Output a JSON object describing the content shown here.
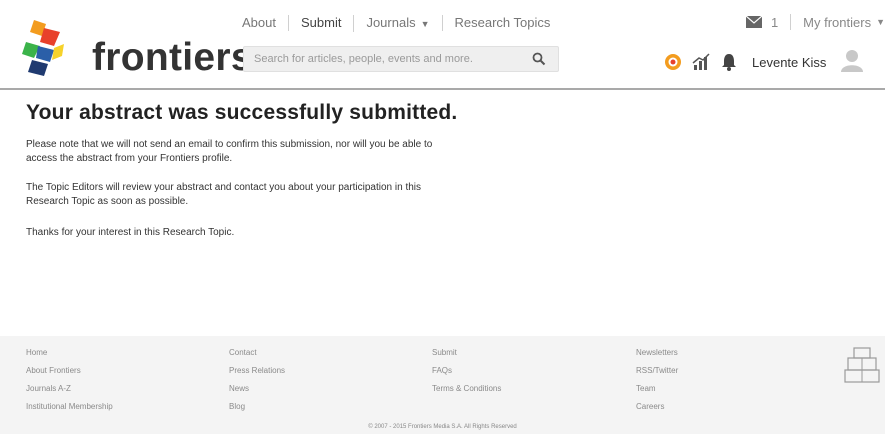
{
  "header": {
    "logo_text": "frontiers",
    "nav": [
      {
        "label": "About"
      },
      {
        "label": "Submit"
      },
      {
        "label": "Journals"
      },
      {
        "label": "Research Topics"
      }
    ],
    "search_placeholder": "Search for articles, people, events and more.",
    "mail_count": "1",
    "my_frontiers_label": "My frontiers",
    "user_name": "Levente Kiss"
  },
  "main": {
    "title": "Your abstract was successfully submitted.",
    "paragraph_1": "Please note that we will not send an email to confirm this submission, nor will you be able to access the abstract from your Frontiers profile.",
    "paragraph_2": "The Topic Editors will review your abstract and contact you about your participation in this Research Topic as soon as possible.",
    "paragraph_3": "Thanks for your interest in this Research Topic."
  },
  "footer": {
    "columns": [
      [
        "Home",
        "About Frontiers",
        "Journals A-Z",
        "Institutional Membership"
      ],
      [
        "Contact",
        "Press Relations",
        "News",
        "Blog"
      ],
      [
        "Submit",
        "FAQs",
        "Terms & Conditions"
      ],
      [
        "Newsletters",
        "RSS/Twitter",
        "Team",
        "Careers"
      ]
    ],
    "copyright": "© 2007 - 2015 Frontiers Media S.A. All Rights Reserved"
  },
  "colors": {
    "logo_orange": "#f39c1f",
    "logo_red": "#e8412b",
    "logo_blue": "#2b5fa8",
    "logo_green": "#3bb34a",
    "logo_yellow": "#f6d22a",
    "logo_navy": "#1f3a70"
  }
}
